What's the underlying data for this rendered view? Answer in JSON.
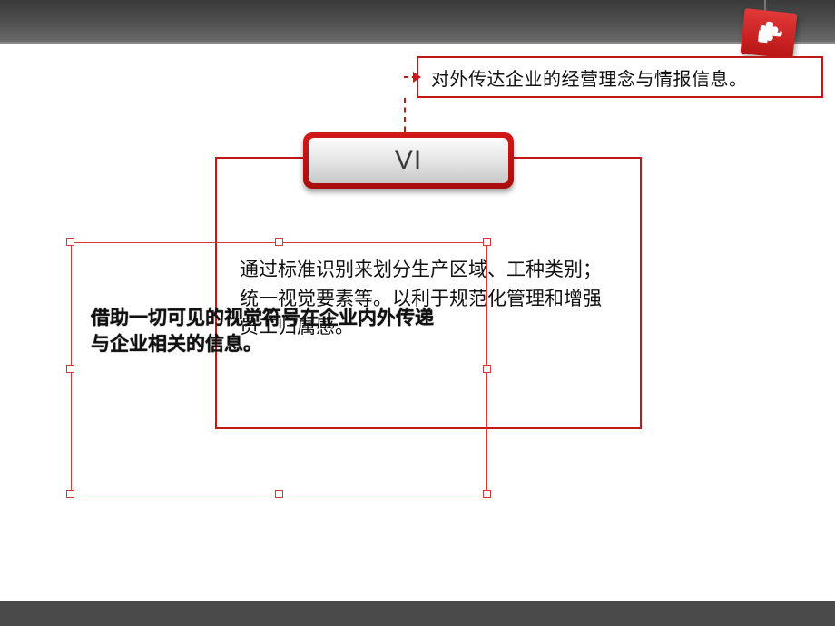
{
  "callout": {
    "text": "对外传达企业的经营理念与情报信息。"
  },
  "tab": {
    "label": "VI"
  },
  "main_body": {
    "text": "通过标准识别来划分生产区域、工种类别；统一视觉要素等。以利于规范化管理和增强员工归属感。"
  },
  "overlay_textbox": {
    "text": "借助一切可见的视觉符号在企业内外传递与企业相关的信息。"
  },
  "icons": {
    "ribbon": "puzzle-piece-icon"
  }
}
